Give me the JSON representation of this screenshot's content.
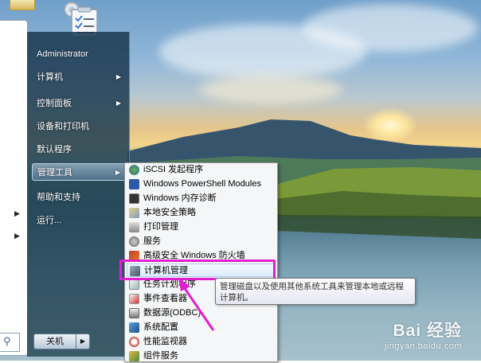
{
  "colors": {
    "start_panel": "#1c3a52",
    "submenu_bg": "#f5f6f7",
    "annotation_magenta": "#e020d0",
    "hover_border": "#aecff7"
  },
  "start_menu": {
    "user_name": "Administrator",
    "items": [
      {
        "label": "计算机",
        "has_submenu": true
      },
      {
        "label": "控制面板",
        "has_submenu": true
      },
      {
        "label": "设备和打印机",
        "has_submenu": false
      },
      {
        "label": "默认程序",
        "has_submenu": false
      },
      {
        "label": "管理工具",
        "has_submenu": true,
        "active": true
      },
      {
        "label": "帮助和支持",
        "has_submenu": false
      },
      {
        "label": "运行...",
        "has_submenu": false
      }
    ],
    "shutdown_label": "关机",
    "shutdown_more_icon": "chevron-right-icon",
    "search_icon": "search-icon"
  },
  "submenu": {
    "items": [
      {
        "label": "iSCSI 发起程序",
        "icon": "iscsi-icon"
      },
      {
        "label": "Windows PowerShell Modules",
        "icon": "powershell-icon"
      },
      {
        "label": "Windows 内存诊断",
        "icon": "memory-diagnostic-icon"
      },
      {
        "label": "本地安全策略",
        "icon": "security-policy-icon"
      },
      {
        "label": "打印管理",
        "icon": "print-management-icon"
      },
      {
        "label": "服务",
        "icon": "services-icon"
      },
      {
        "label": "高级安全 Windows 防火墙",
        "icon": "firewall-icon"
      },
      {
        "label": "计算机管理",
        "icon": "computer-management-icon",
        "hover": true
      },
      {
        "label": "任务计划程序",
        "icon": "task-scheduler-icon"
      },
      {
        "label": "事件查看器",
        "icon": "event-viewer-icon"
      },
      {
        "label": "数据源(ODBC)",
        "icon": "odbc-icon"
      },
      {
        "label": "系统配置",
        "icon": "system-config-icon"
      },
      {
        "label": "性能监视器",
        "icon": "performance-monitor-icon"
      },
      {
        "label": "组件服务",
        "icon": "component-services-icon"
      }
    ]
  },
  "tooltip": {
    "text": "管理磁盘以及使用其他系统工具来管理本地或远程计算机。"
  },
  "watermark": {
    "logo": "Bai 经验",
    "url": "jingyan.baidu.com"
  }
}
